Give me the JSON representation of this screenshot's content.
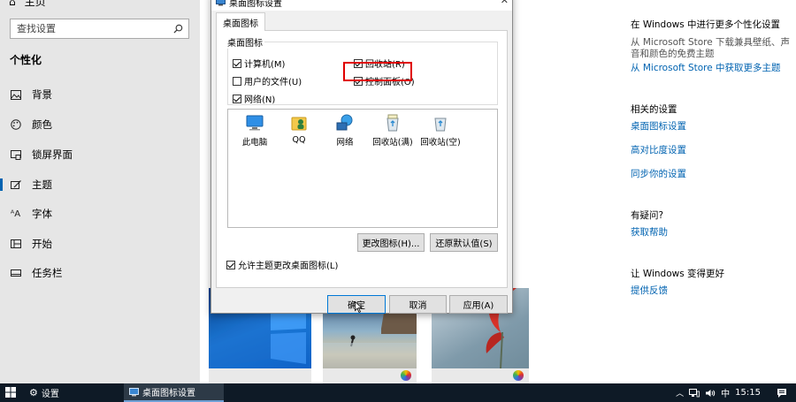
{
  "sidebar": {
    "home_label": "主页",
    "search_placeholder": "查找设置",
    "section_title": "个性化",
    "items": [
      {
        "label": "背景",
        "icon": "image-icon"
      },
      {
        "label": "颜色",
        "icon": "palette-icon"
      },
      {
        "label": "锁屏界面",
        "icon": "lock-screen-icon"
      },
      {
        "label": "主题",
        "icon": "theme-icon"
      },
      {
        "label": "字体",
        "icon": "font-icon"
      },
      {
        "label": "开始",
        "icon": "start-grid-icon"
      },
      {
        "label": "任务栏",
        "icon": "taskbar-icon"
      }
    ],
    "active_item": "主题"
  },
  "right_panel": {
    "more_heading": "在 Windows 中进行更多个性化设置",
    "more_desc_1": "从 Microsoft Store 下载兼具壁纸、声",
    "more_desc_2": "音和颜色的免费主题",
    "more_link": "从 Microsoft Store 中获取更多主题",
    "related_heading": "相关的设置",
    "related_links": [
      "桌面图标设置",
      "高对比度设置",
      "同步你的设置"
    ],
    "help_heading": "有疑问?",
    "help_link": "获取帮助",
    "improve_heading": "让 Windows 变得更好",
    "feedback_link": "提供反馈"
  },
  "dialog": {
    "title": "桌面图标设置",
    "tab_label": "桌面图标",
    "group_label": "桌面图标",
    "checkboxes": [
      {
        "label": "计算机(M)",
        "checked": true
      },
      {
        "label": "回收站(R)",
        "checked": true
      },
      {
        "label": "用户的文件(U)",
        "checked": false
      },
      {
        "label": "控制面板(O)",
        "checked": true
      },
      {
        "label": "网络(N)",
        "checked": true
      }
    ],
    "icons": [
      {
        "label": "此电脑",
        "icon": "this-pc-icon"
      },
      {
        "label": "QQ",
        "icon": "user-folder-icon"
      },
      {
        "label": "网络",
        "icon": "network-icon"
      },
      {
        "label": "回收站(满)",
        "icon": "recycle-bin-full-icon"
      },
      {
        "label": "回收站(空)",
        "icon": "recycle-bin-empty-icon"
      }
    ],
    "change_icon_button": "更改图标(H)...",
    "restore_default_button": "还原默认值(S)",
    "allow_themes_label": "允许主题更改桌面图标(L)",
    "allow_themes_checked": true,
    "ok_button": "确定",
    "cancel_button": "取消",
    "apply_button": "应用(A)"
  },
  "taskbar": {
    "apps": [
      {
        "label": "设置",
        "icon": "gear-icon"
      },
      {
        "label": "桌面图标设置",
        "icon": "desktop-window-icon"
      }
    ],
    "ime": "中",
    "time": "15:15"
  },
  "colors": {
    "accent": "#0063b1",
    "highlight": "#e00000",
    "taskbar": "#0e1a26"
  }
}
